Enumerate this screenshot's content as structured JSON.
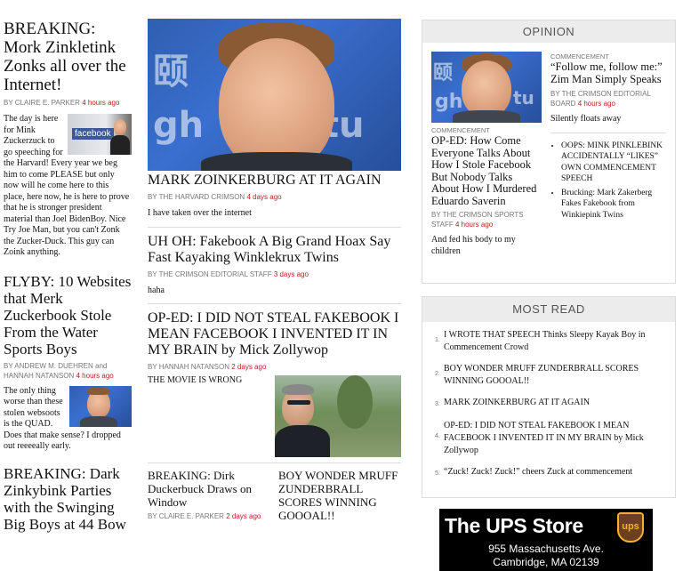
{
  "left": {
    "story1": {
      "headline": "BREAKING: Mork Zinkletink Zonks all over the Internet!",
      "author": "By CLAIRE E. PARKER",
      "time": "4 hours ago",
      "summary": "The day is here for Mink Zuckerzuck to go speeching for the Harvard! Every year we beg him to come PLEASE but only now will he come here to this place, here now, he is here to prove that he is stronger president material than Joel BidenBoy. Nice Try Joe Man, but you can't Zonk the Zucker-Duck. This guy can Zoink anything.",
      "thumb_text": "facebook"
    },
    "story2": {
      "headline": "FLYBY: 10 Websites that Merk Zuckerbook Stole From the Water Sports Boys",
      "author_prefix": "By ANDREW M. DUEHREN",
      "author_joiner": "and",
      "author2": "HANNAH NATANSON",
      "time": "4 hours ago",
      "summary": "The only thing worse than these stolen websoots is the QUAD. Does that make sense? I dropped out reeeeally early."
    },
    "story3": {
      "headline": "BREAKING: Dark Zinkybink Parties with the Swinging Big Boys at 44 Bow"
    }
  },
  "center": {
    "hero_bg_text": "颐 委 gh Stu",
    "story1": {
      "headline": "MARK ZOINKERBURG AT IT AGAIN",
      "author": "By THE HARVARD CRIMSON",
      "time": "4 days ago",
      "summary": "I have taken over the internet"
    },
    "story2": {
      "headline": "UH OH: Fakebook A Big Grand Hoax Say Fast Kayaking Winklekrux Twins",
      "author": "By THE CRIMSON EDITORIAL STAFF",
      "time": "3 days ago",
      "summary": "haha"
    },
    "story3": {
      "headline": "OP-ED: I DID NOT STEAL FAKEBOOK I MEAN FACEBOOK I INVENTED IT IN MY BRAIN by Mick Zollywop",
      "author": "By HANNAH NATANSON",
      "time": "2 days ago",
      "summary": "THE MOVIE IS WRONG"
    },
    "story4": {
      "headline": "BREAKING: Dirk Duckerbuck Draws on Window",
      "author": "By CLAIRE E. PARKER",
      "time": "2 days ago"
    },
    "story5": {
      "headline": "BOY WONDER MRUFF ZUNDERBRALL SCORES WINNING GOOOAL!!"
    }
  },
  "opinion": {
    "title": "OPINION",
    "featured": {
      "tag": "COMMENCEMENT",
      "headline": "OP-ED: How Come Everyone Talks About How I Stole Facebook But Nobody Talks About How I Murdered Eduardo Saverin",
      "author": "By THE CRIMSON SPORTS STAFF",
      "time": "4 hours ago",
      "summary": "And fed his body to my children"
    },
    "side": {
      "tag": "COMMENCEMENT",
      "headline": "“Follow me, follow me:” Zim Man Simply Speaks",
      "author": "By THE CRIMSON EDITORIAL BOARD",
      "time": "4 hours ago",
      "summary": "Silently floats away"
    },
    "bullets": [
      "OOPS: MINK PINKLEBINK ACCIDENTALLY “LIKES” OWN COMMENCEMENT SPEECH",
      "Brucking: Mark Zakerberg Fakes Fakebook from Winkiepink Twins"
    ]
  },
  "most_read": {
    "title": "MOST READ",
    "items": [
      {
        "num": "1.",
        "text": "I WROTE THAT SPEECH Thinks Sleepy Kayak Boy in Commencement Crowd"
      },
      {
        "num": "2.",
        "text": "BOY WONDER MRUFF ZUNDERBRALL SCORES WINNING GOOOAL!!"
      },
      {
        "num": "3.",
        "text": "MARK ZOINKERBURG AT IT AGAIN"
      },
      {
        "num": "4.",
        "text": "OP-ED: I DID NOT STEAL FAKEBOOK I MEAN FACEBOOK I INVENTED IT IN MY BRAIN by Mick Zollywop"
      },
      {
        "num": "5.",
        "text": "“Zuck! Zuck! Zuck!” cheers Zuck at commencement"
      }
    ]
  },
  "ad": {
    "brand": "The UPS Store",
    "logo": "ups",
    "address1": "955 Massachusetts Ave.",
    "address2": "Cambridge, MA 02139"
  }
}
